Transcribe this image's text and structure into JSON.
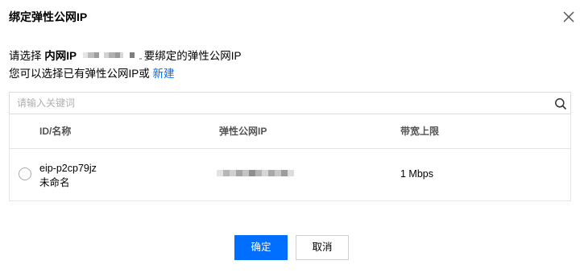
{
  "dialog": {
    "title": "绑定弹性公网IP",
    "close_icon": "close-icon"
  },
  "intro": {
    "prefix": "请选择 ",
    "private_ip_label": "内网IP",
    "suffix": "要绑定的弹性公网IP",
    "line2_text": "您可以选择已有弹性公网IP或 ",
    "create_link": "新建"
  },
  "search": {
    "placeholder": "请输入关键词",
    "icon": "search-icon"
  },
  "table": {
    "columns": [
      "ID/名称",
      "弹性公网IP",
      "带宽上限"
    ],
    "rows": [
      {
        "id": "eip-p2cp79jz",
        "name": "未命名",
        "bandwidth": "1 Mbps"
      }
    ]
  },
  "footer": {
    "confirm_label": "确定",
    "cancel_label": "取消"
  },
  "colors": {
    "primary": "#006eff",
    "border": "#dddddd"
  }
}
